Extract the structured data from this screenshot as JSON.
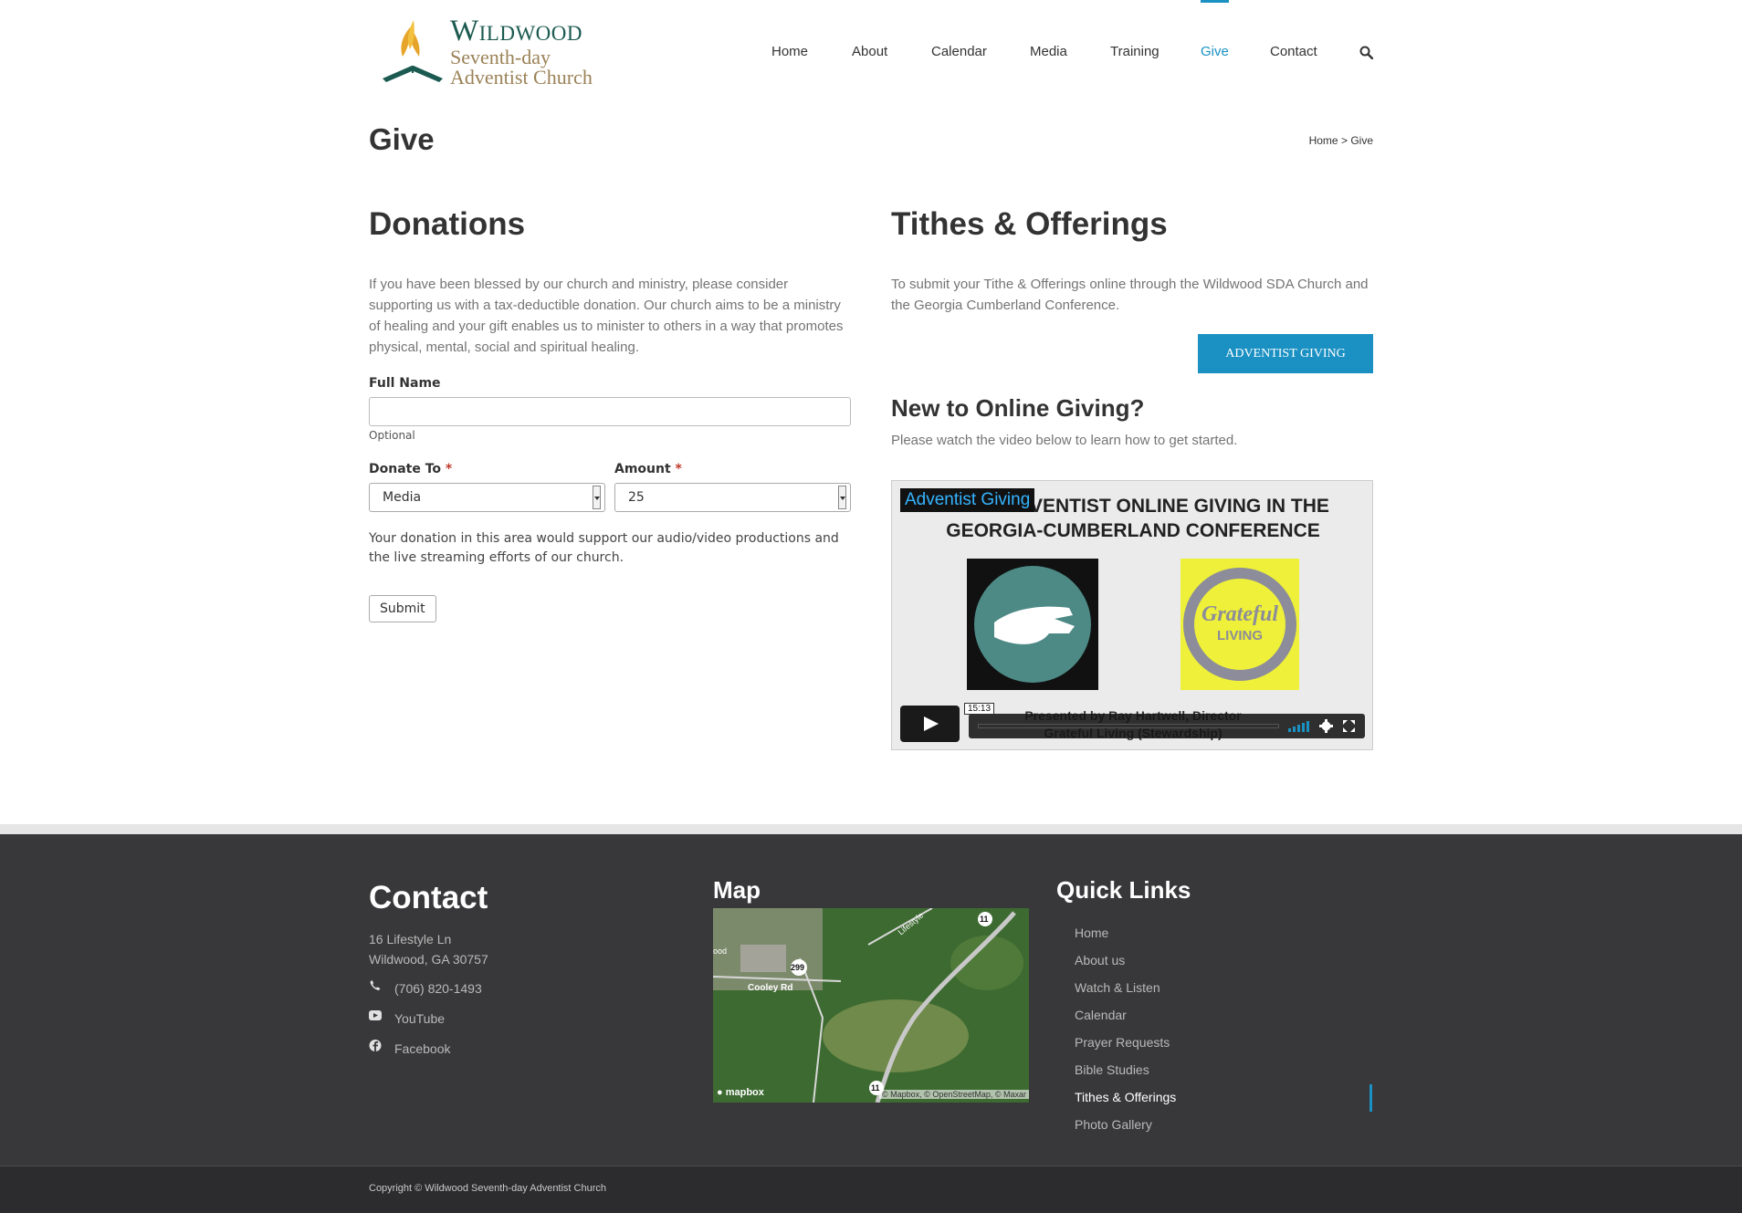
{
  "header": {
    "logo": {
      "line1": "Wildwood",
      "line2": "Seventh-day",
      "line3": "Adventist Church"
    },
    "nav": [
      "Home",
      "About",
      "Calendar",
      "Media",
      "Training",
      "Give",
      "Contact"
    ],
    "active_nav": "Give",
    "search_icon": "search-icon"
  },
  "title": {
    "text": "Give"
  },
  "breadcrumb": {
    "home": "Home",
    "sep": ">",
    "current": "Give"
  },
  "donations": {
    "heading": "Donations",
    "intro": "If you have been blessed by our church and ministry, please consider supporting us with a tax-deductible donation. Our church aims to be a ministry of healing and your gift enables us to minister to others in a way that promotes physical, mental, social and spiritual healing.",
    "full_name_label": "Full Name",
    "full_name_value": "",
    "full_name_hint": "Optional",
    "donate_to_label": "Donate To",
    "donate_to_value": "Media",
    "amount_label": "Amount",
    "amount_value": "25",
    "required_mark": "*",
    "help_text": "Your donation in this area would support our audio/video productions and the live streaming efforts of our church.",
    "submit_label": "Submit"
  },
  "tithes": {
    "heading": "Tithes & Offerings",
    "intro": "To submit your Tithe & Offerings online through the Wildwood SDA Church and the Georgia Cumberland Conference.",
    "button_label": "ADVENTIST GIVING",
    "sub_heading": "New to Online Giving?",
    "sub_text": "Please watch the video below to learn how to get started."
  },
  "video": {
    "badge": "Adventist Giving",
    "headline_line1": "USING ADVENTIST ONLINE GIVING IN THE",
    "headline_line2": "GEORGIA-CUMBERLAND CONFERENCE",
    "image2_line1": "Grateful",
    "image2_line2": "LIVING",
    "presenter_line1": "Presented by Ray Hartwell, Director",
    "presenter_line2": "Grateful Living (Stewardship)",
    "duration": "15:13"
  },
  "footer": {
    "contact": {
      "heading": "Contact",
      "address1": "16 Lifestyle Ln",
      "address2": "Wildwood, GA 30757",
      "phone": "(706) 820-1493",
      "youtube": "YouTube",
      "facebook": "Facebook"
    },
    "map": {
      "heading": "Map",
      "labels": {
        "road": "Cooley Rd",
        "lifestyle": "Lifestyle",
        "route299": "299",
        "route11": "11",
        "place": "ood"
      },
      "brand": "mapbox",
      "attribution": "© Mapbox, © OpenStreetMap, © Maxar"
    },
    "quick_links": {
      "heading": "Quick Links",
      "items": [
        "Home",
        "About us",
        "Watch & Listen",
        "Calendar",
        "Prayer Requests",
        "Bible Studies",
        "Tithes & Offerings",
        "Photo Gallery"
      ],
      "active": "Tithes & Offerings"
    }
  },
  "copyright": "Copyright © Wildwood Seventh-day Adventist Church",
  "colors": {
    "accent": "#1b91c3",
    "footer_bg": "#38383a",
    "copyright_bg": "#2c2c2e",
    "text": "#333333"
  }
}
